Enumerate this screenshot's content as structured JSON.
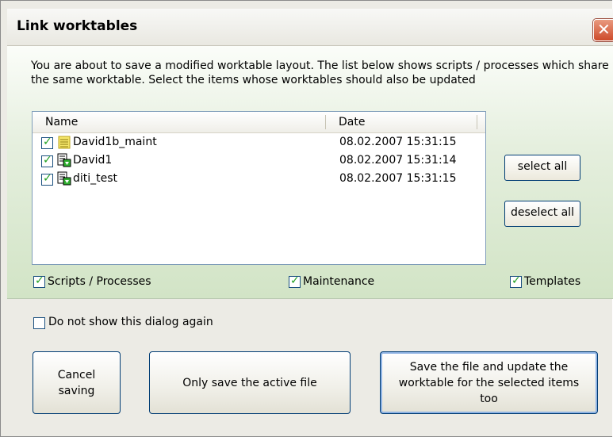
{
  "window": {
    "title": "Link worktables",
    "close_glyph": "✕"
  },
  "description": "You are about to save a modified worktable layout. The list below shows scripts / processes which share the same worktable. Select the items whose worktables should also be updated",
  "list": {
    "columns": {
      "name": "Name",
      "date": "Date"
    },
    "rows": [
      {
        "name": "David1b_maint",
        "date": "08.02.2007 15:31:15",
        "checked": true,
        "icon": "maintenance-doc-icon"
      },
      {
        "name": "David1",
        "date": "08.02.2007 15:31:14",
        "checked": true,
        "icon": "script-process-icon"
      },
      {
        "name": "diti_test",
        "date": "08.02.2007 15:31:15",
        "checked": true,
        "icon": "script-process-icon"
      }
    ]
  },
  "side_buttons": {
    "select_all": "select all",
    "deselect_all": "deselect all"
  },
  "filters": {
    "scripts": {
      "label": "Scripts / Processes",
      "checked": true
    },
    "maintenance": {
      "label": "Maintenance",
      "checked": true
    },
    "templates": {
      "label": "Templates",
      "checked": true
    }
  },
  "do_not_show": {
    "label": "Do not show this dialog again",
    "checked": false
  },
  "buttons": {
    "cancel": "Cancel saving",
    "only_save": "Only save the active file",
    "save_update": "Save the file and update the worktable for the selected items too"
  },
  "colors": {
    "accent": "#003c74",
    "panel": "#d2e4c6",
    "check": "#21a121"
  }
}
